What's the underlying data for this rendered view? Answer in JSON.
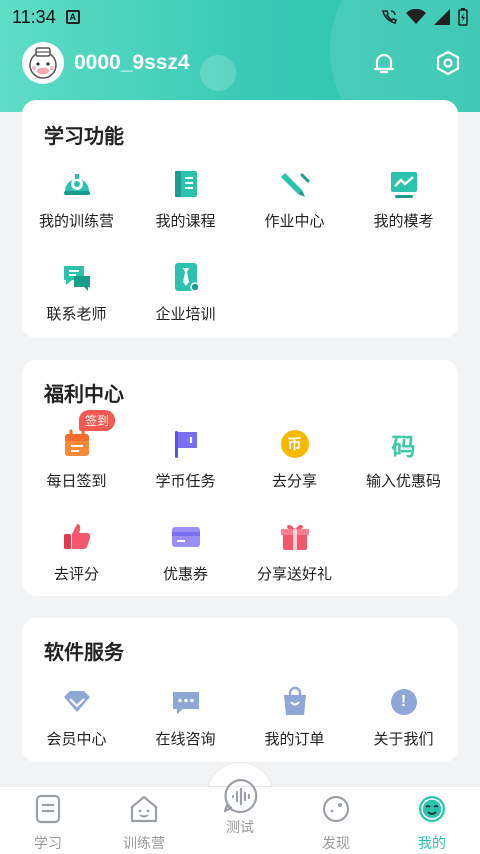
{
  "status": {
    "time": "11:34",
    "notif_glyph": "A"
  },
  "profile": {
    "username": "0000_9ssz4"
  },
  "learning": {
    "title": "学习功能",
    "items": [
      {
        "label": "我的训练营",
        "icon": "camp-bell-icon"
      },
      {
        "label": "我的课程",
        "icon": "course-book-icon"
      },
      {
        "label": "作业中心",
        "icon": "homework-pen-icon"
      },
      {
        "label": "我的模考",
        "icon": "mock-exam-chart-icon"
      },
      {
        "label": "联系老师",
        "icon": "contact-teacher-chat-icon"
      },
      {
        "label": "企业培训",
        "icon": "enterprise-training-tie-icon"
      }
    ]
  },
  "welfare": {
    "title": "福利中心",
    "items": [
      {
        "label": "每日签到",
        "icon": "calendar-checkin-icon",
        "badge": "签到"
      },
      {
        "label": "学币任务",
        "icon": "flag-task-icon"
      },
      {
        "label": "去分享",
        "icon": "coin-share-icon",
        "glyph": "币"
      },
      {
        "label": "输入优惠码",
        "icon": "promo-code-icon",
        "glyph": "码"
      },
      {
        "label": "去评分",
        "icon": "thumbs-up-icon"
      },
      {
        "label": "优惠券",
        "icon": "coupon-card-icon"
      },
      {
        "label": "分享送好礼",
        "icon": "gift-icon"
      }
    ]
  },
  "service": {
    "title": "软件服务",
    "items": [
      {
        "label": "会员中心",
        "icon": "diamond-vip-icon"
      },
      {
        "label": "在线咨询",
        "icon": "chat-consult-icon"
      },
      {
        "label": "我的订单",
        "icon": "shopping-bag-order-icon"
      },
      {
        "label": "关于我们",
        "icon": "info-exclamation-icon",
        "glyph": "!"
      }
    ]
  },
  "nav": {
    "items": [
      {
        "label": "学习",
        "icon": "study-tab-icon"
      },
      {
        "label": "训练营",
        "icon": "camp-house-tab-icon"
      },
      {
        "label": "测试",
        "icon": "test-voice-tab-icon"
      },
      {
        "label": "发现",
        "icon": "discover-tab-icon"
      },
      {
        "label": "我的",
        "icon": "mine-smile-tab-icon"
      }
    ],
    "active": "我的"
  },
  "colors": {
    "accent": "#2cc3ae",
    "badge": "#f55a52",
    "purple": "#7b6ef0",
    "gold": "#f6b900",
    "pink": "#f2576b",
    "blue_gray": "#8fa7d6"
  }
}
